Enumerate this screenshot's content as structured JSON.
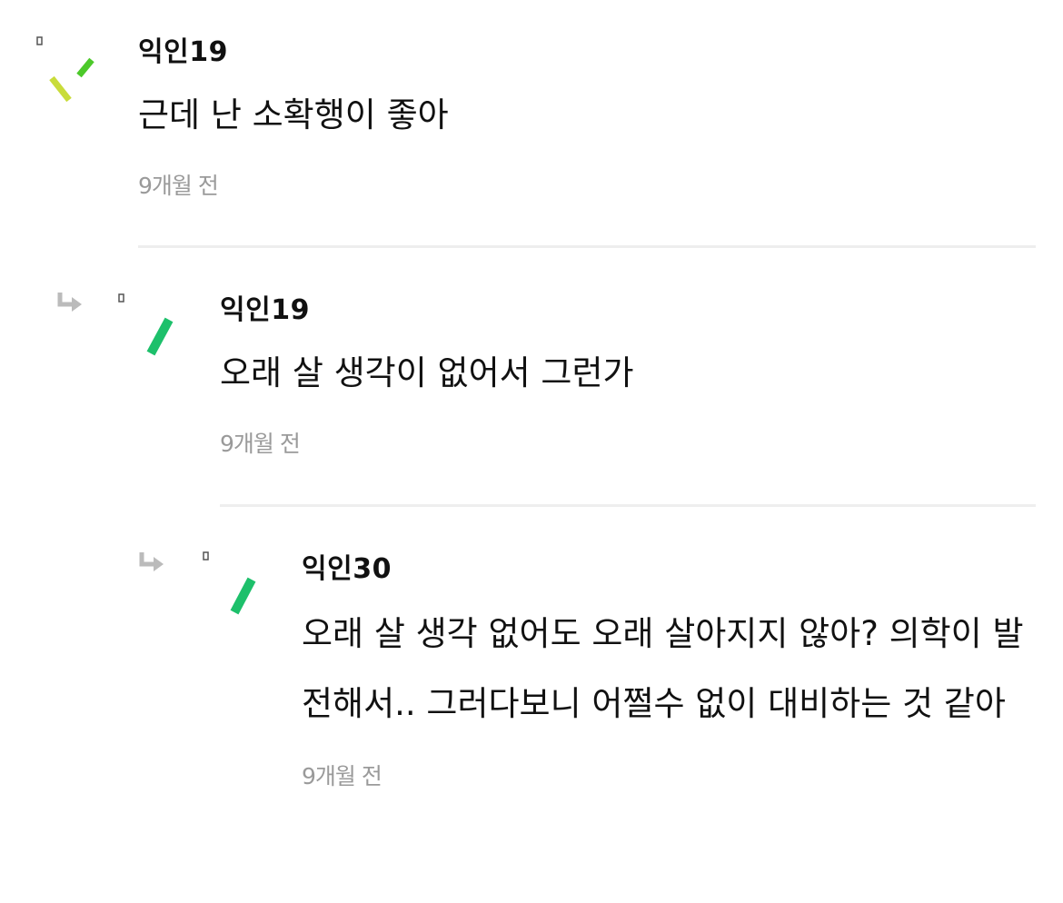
{
  "comments": [
    {
      "author": "익인19",
      "text": "근데 난 소확행이 좋아",
      "time": "9개월 전",
      "is_reply": false
    },
    {
      "author": "익인19",
      "text": "오래 살 생각이 없어서 그런가",
      "time": "9개월 전",
      "is_reply": true
    },
    {
      "author": "익인30",
      "text": "오래 살 생각 없어도 오래 살아지지 않아? 의학이 발전해서.. 그러다보니 어쩔수 없이 대비하는 것 같아",
      "time": "9개월 전",
      "is_reply": true
    }
  ],
  "icons": {
    "avatar": "broken-image-avatar-icon",
    "reply": "reply-arrow-icon"
  },
  "colors": {
    "text": "#111111",
    "timestamp": "#9a9a9a",
    "divider": "#eeeeee",
    "reply_arrow": "#bbbbbb",
    "avatar_lime": "#c9dc3a",
    "avatar_green": "#4cc92a",
    "avatar_emerald": "#1dc06b"
  }
}
